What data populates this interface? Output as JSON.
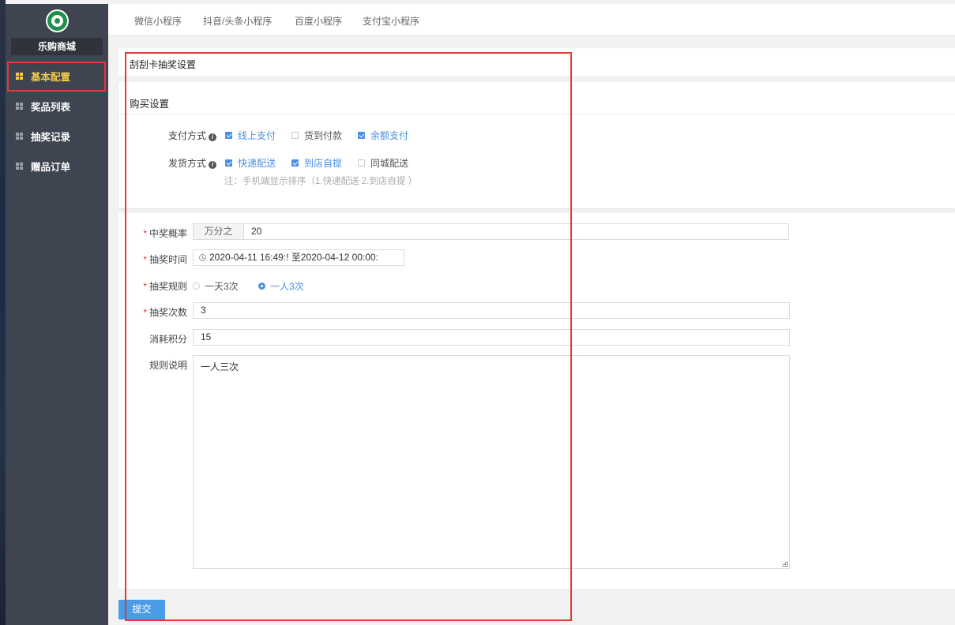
{
  "sidebar": {
    "shop_name": "乐购商城",
    "items": [
      {
        "label": "基本配置",
        "active": true
      },
      {
        "label": "奖品列表",
        "active": false
      },
      {
        "label": "抽奖记录",
        "active": false
      },
      {
        "label": "赠品订单",
        "active": false
      }
    ]
  },
  "topnav": {
    "tabs": [
      "微信小程序",
      "抖音/头条小程序",
      "百度小程序",
      "支付宝小程序"
    ]
  },
  "page": {
    "title": "刮刮卡抽奖设置"
  },
  "buy_settings": {
    "title": "购买设置",
    "payment": {
      "label": "支付方式",
      "options": [
        {
          "label": "线上支付",
          "checked": true
        },
        {
          "label": "货到付款",
          "checked": false
        },
        {
          "label": "余额支付",
          "checked": true
        }
      ]
    },
    "delivery": {
      "label": "发货方式",
      "options": [
        {
          "label": "快递配送",
          "checked": true
        },
        {
          "label": "到店自提",
          "checked": true
        },
        {
          "label": "同城配送",
          "checked": false
        }
      ]
    },
    "note": "注：手机端显示排序（1.快递配送 2.到店自提 ）"
  },
  "form": {
    "win_rate": {
      "label": "中奖概率",
      "required": true,
      "addon": "万分之",
      "value": "20"
    },
    "draw_time": {
      "label": "抽奖时间",
      "required": true,
      "value": "2020-04-11 16:49:! 至2020-04-12 00:00:"
    },
    "draw_rule": {
      "label": "抽奖规则",
      "required": true,
      "options": [
        {
          "label": "一天3次",
          "selected": false
        },
        {
          "label": "一人3次",
          "selected": true
        }
      ]
    },
    "draw_count": {
      "label": "抽奖次数",
      "required": true,
      "value": "3"
    },
    "points_cost": {
      "label": "消耗积分",
      "required": false,
      "value": "15"
    },
    "rule_desc": {
      "label": "规则说明",
      "required": false,
      "value": "一人三次"
    }
  },
  "submit_label": "提交",
  "colors": {
    "accent": "#4a90e2",
    "highlight": "#e53935",
    "sidebar_bg": "#3e4550",
    "active_menu": "#f6c94a"
  }
}
